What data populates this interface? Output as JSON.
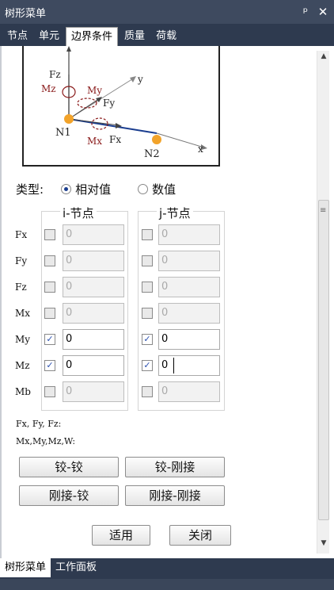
{
  "title": "树形菜单",
  "title_controls": [
    "ᵖ",
    "✕"
  ],
  "tabs": [
    "节点",
    "单元",
    "边界条件",
    "质量",
    "荷载"
  ],
  "active_tab": 2,
  "diagram": {
    "labels": [
      "Fz",
      "Mz",
      "My",
      "y",
      "Fy",
      "N1",
      "Mx",
      "Fx",
      "N2",
      "x"
    ]
  },
  "type": {
    "label": "类型:",
    "option_relative": "相对值",
    "option_value": "数值",
    "selected": "相对值"
  },
  "i_node_header": "i-节点",
  "j_node_header": "j-节点",
  "rows": [
    {
      "label": "Fx",
      "i_checked": false,
      "i_value": "0",
      "j_checked": false,
      "j_value": "0"
    },
    {
      "label": "Fy",
      "i_checked": false,
      "i_value": "0",
      "j_checked": false,
      "j_value": "0"
    },
    {
      "label": "Fz",
      "i_checked": false,
      "i_value": "0",
      "j_checked": false,
      "j_value": "0"
    },
    {
      "label": "Mx",
      "i_checked": false,
      "i_value": "0",
      "j_checked": false,
      "j_value": "0"
    },
    {
      "label": "My",
      "i_checked": true,
      "i_value": "0",
      "j_checked": true,
      "j_value": "0"
    },
    {
      "label": "Mz",
      "i_checked": true,
      "i_value": "0",
      "j_checked": true,
      "j_value": "0"
    },
    {
      "label": "Mb",
      "i_checked": false,
      "i_value": "0",
      "j_checked": false,
      "j_value": "0"
    }
  ],
  "notes": [
    "Fx, Fy, Fz:",
    "Mx,My,Mz,W:"
  ],
  "preset_buttons": [
    "铰-铰",
    "铰-刚接",
    "刚接-铰",
    "刚接-刚接"
  ],
  "apply_label": "适用",
  "close_label": "关闭",
  "bottom_tabs": [
    "树形菜单",
    "工作面板"
  ],
  "bottom_active": 0
}
